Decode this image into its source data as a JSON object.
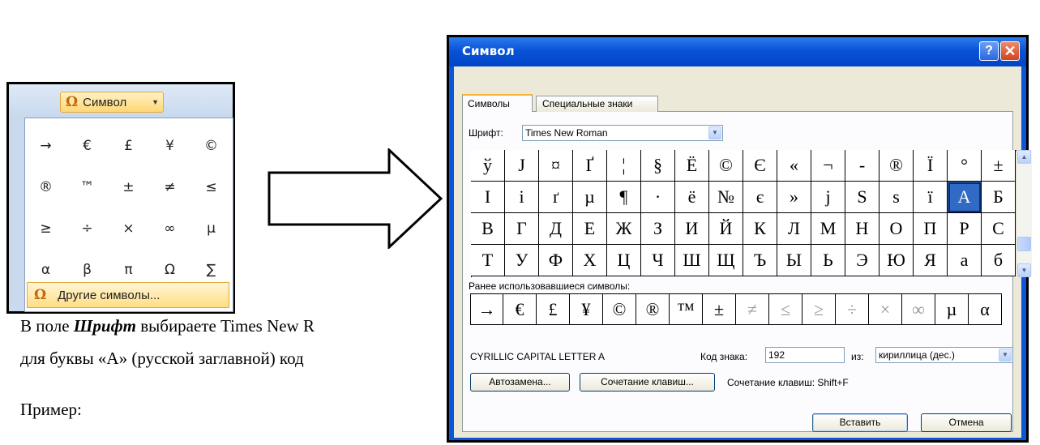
{
  "ribbon": {
    "button_icon": "Ω",
    "button_label": "Символ",
    "gallery": [
      [
        "→",
        "€",
        "£",
        "¥",
        "©"
      ],
      [
        "®",
        "™",
        "±",
        "≠",
        "≤"
      ],
      [
        "≥",
        "÷",
        "×",
        "∞",
        "µ"
      ],
      [
        "α",
        "β",
        "π",
        "Ω",
        "∑"
      ]
    ],
    "more_icon": "Ω",
    "more_label": "Другие символы..."
  },
  "document": {
    "line1_prefix": "В поле ",
    "line1_bold": "Шрифт",
    "line1_suffix": " выбираете Times New R",
    "line2": "для буквы «А» (русской заглавной) код",
    "line3": "Пример:"
  },
  "dialog": {
    "title": "Символ",
    "help_glyph": "?",
    "close_glyph": "✕",
    "tabs": [
      "Символы",
      "Специальные знаки"
    ],
    "font_label": "Шрифт:",
    "font_value": "Times New Roman",
    "symbol_rows": [
      [
        "ў",
        "J",
        "¤",
        "Ґ",
        "¦",
        "§",
        "Ё",
        "©",
        "Є",
        "«",
        "¬",
        "-",
        "®",
        "Ї",
        "°",
        "±"
      ],
      [
        "І",
        "і",
        "ґ",
        "µ",
        "¶",
        "·",
        "ё",
        "№",
        "є",
        "»",
        "ј",
        "Ѕ",
        "ѕ",
        "ї",
        "А",
        "Б"
      ],
      [
        "В",
        "Г",
        "Д",
        "Е",
        "Ж",
        "З",
        "И",
        "Й",
        "К",
        "Л",
        "М",
        "Н",
        "О",
        "П",
        "Р",
        "С"
      ],
      [
        "Т",
        "У",
        "Ф",
        "Х",
        "Ц",
        "Ч",
        "Ш",
        "Щ",
        "Ъ",
        "Ы",
        "Ь",
        "Э",
        "Ю",
        "Я",
        "а",
        "б"
      ]
    ],
    "selected_symbol": "А",
    "recent_label": "Ранее использовавшиеся символы:",
    "recent_symbols": [
      "→",
      "€",
      "£",
      "¥",
      "©",
      "®",
      "™",
      "±",
      "≠",
      "≤",
      "≥",
      "÷",
      "×",
      "∞",
      "µ",
      "α"
    ],
    "char_name": "CYRILLIC CAPITAL LETTER A",
    "code_label": "Код знака:",
    "code_value": "192",
    "from_label": "из:",
    "from_value": "кириллица (дес.)",
    "autocorrect_button": "Автозамена...",
    "shortcut_button": "Сочетание клавиш...",
    "shortcut_info": "Сочетание клавиш: Shift+F",
    "insert_button": "Вставить",
    "cancel_button": "Отмена"
  },
  "icons": {
    "arrow": "right-arrow-outline",
    "combo": "chevron-down-icon",
    "scroll_up": "scroll-up-icon",
    "scroll_down": "scroll-down-icon"
  },
  "colors": {
    "titlebar": "#0a53d6",
    "selection": "#316ac5",
    "dialog_face": "#ece9d8",
    "ribbon_highlight": "#ffd775"
  }
}
